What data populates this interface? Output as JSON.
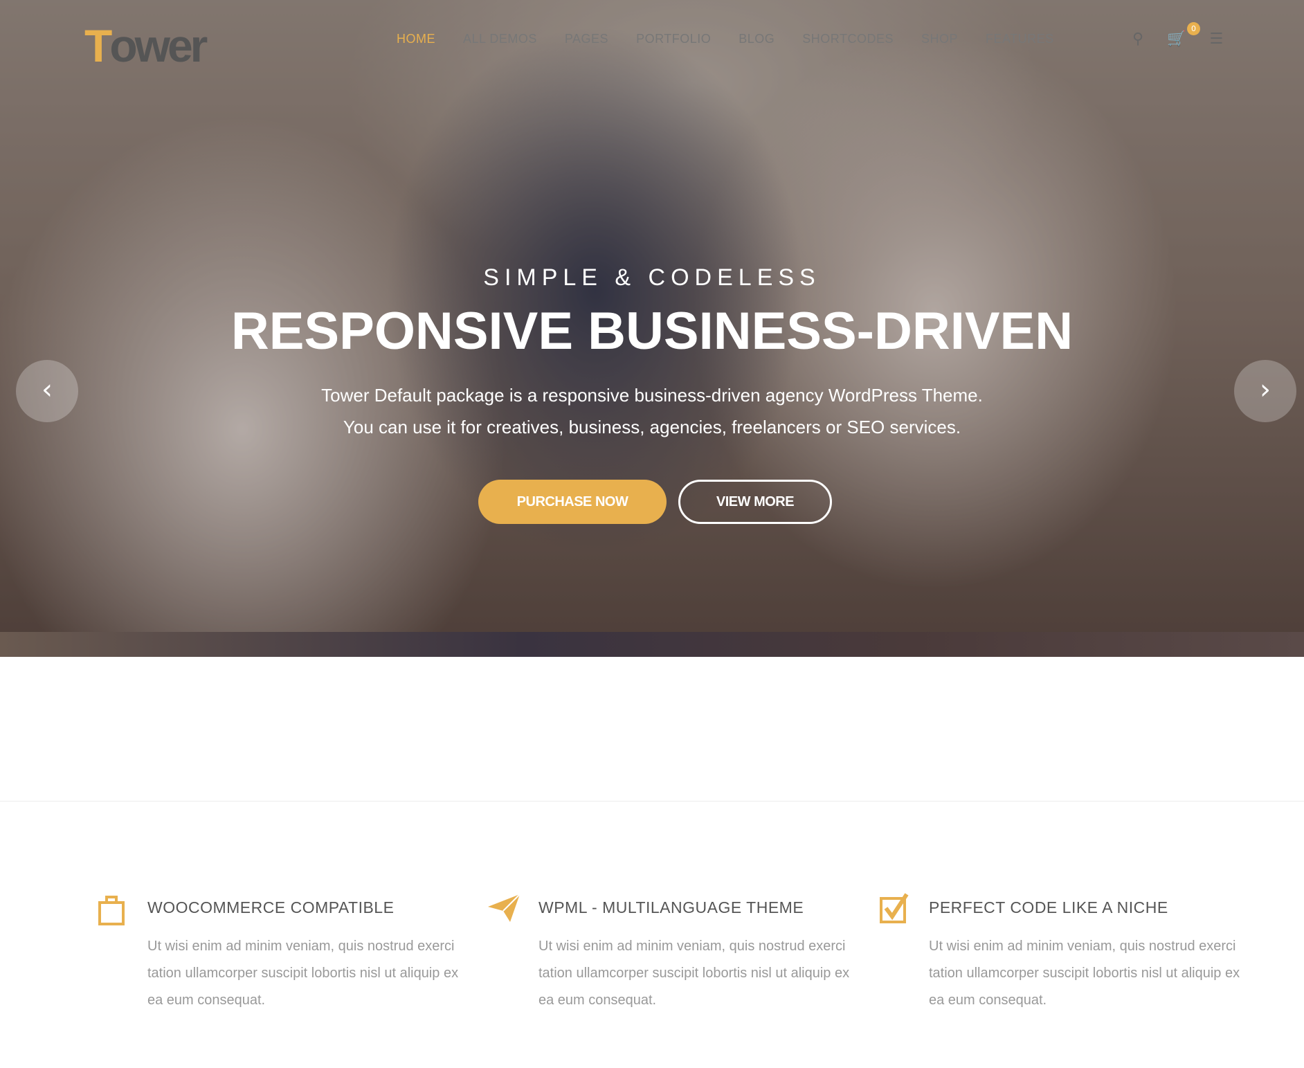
{
  "header": {
    "logo": {
      "first": "T",
      "rest": "ower"
    },
    "nav": [
      {
        "label": "HOME",
        "active": true
      },
      {
        "label": "ALL DEMOS"
      },
      {
        "label": "PAGES"
      },
      {
        "label": "PORTFOLIO"
      },
      {
        "label": "BLOG"
      },
      {
        "label": "SHORTCODES"
      },
      {
        "label": "SHOP"
      },
      {
        "label": "FEATURES"
      }
    ],
    "cart_count": "0",
    "icons": [
      "search-icon",
      "cart-icon",
      "menu-icon"
    ]
  },
  "hero": {
    "subtitle": "SIMPLE & CODELESS",
    "title": "RESPONSIVE BUSINESS-DRIVEN",
    "desc1": "Tower Default package is a responsive business-driven agency WordPress Theme.",
    "desc2": "You can use it for creatives, business, agencies, freelancers or SEO services.",
    "primary": "PURCHASE NOW",
    "secondary": "VIEW MORE"
  },
  "features": [
    {
      "icon": "shopping-bag-icon",
      "title": "WOOCOMMERCE COMPATIBLE",
      "text": "Ut wisi enim ad minim veniam, quis nostrud exerci tation ullamcorper suscipit lobortis nisl ut aliquip ex ea eum consequat."
    },
    {
      "icon": "paper-plane-icon",
      "title": "WPML - MULTILANGUAGE THEME",
      "text": "Ut wisi enim ad minim veniam, quis nostrud exerci tation ullamcorper suscipit lobortis nisl ut aliquip ex ea eum consequat."
    },
    {
      "icon": "checkbox-icon",
      "title": "PERFECT CODE LIKE A NICHE",
      "text": "Ut wisi enim ad minim veniam, quis nostrud exerci tation ullamcorper suscipit lobortis nisl ut aliquip ex ea eum consequat."
    }
  ],
  "colors": {
    "accent": "#e8b04e"
  }
}
